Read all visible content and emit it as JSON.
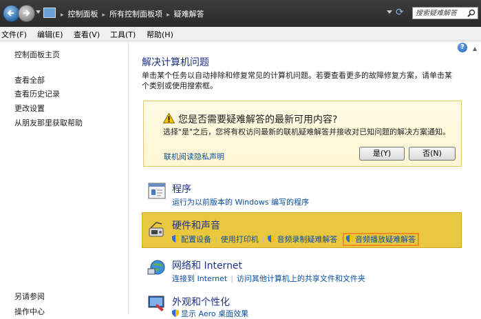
{
  "address_bar": {
    "breadcrumbs": [
      "控制面板",
      "所有控制面板项",
      "疑难解答"
    ],
    "search_placeholder": "搜索疑难解答"
  },
  "menu": [
    "文件(F)",
    "编辑(E)",
    "查看(V)",
    "工具(T)",
    "帮助(H)"
  ],
  "sidebar": {
    "links": [
      "控制面板主页",
      "查看全部",
      "查看历史记录",
      "更改设置",
      "从朋友那里获取帮助"
    ],
    "see_also_heading": "另请参阅",
    "see_also_links": [
      "操作中心"
    ]
  },
  "main": {
    "help_icon_label": "?",
    "title": "解决计算机问题",
    "description": "单击某个任务以自动排除和修复常见的计算机问题。若要查看更多的故障修复方案，请单击某个类别或使用搜索框。",
    "notice": {
      "question": "您是否需要疑难解答的最新可用内容?",
      "body": "选择\"是\"之后，您将有权访问最新的联机疑难解答并接收对已知问题的解决方案通知。",
      "privacy_link": "联机阅读隐私声明",
      "yes_button": "是(Y)",
      "no_button": "否(N)"
    },
    "categories": [
      {
        "title": "程序",
        "links": [
          "运行为以前版本的 Windows 编写的程序"
        ]
      },
      {
        "title": "硬件和声音",
        "links": [
          "配置设备",
          "使用打印机",
          "音频录制疑难解答",
          "音频播放疑难解答"
        ]
      },
      {
        "title": "网络和 Internet",
        "links": [
          "连接到 Internet",
          "访问其他计算机上的共享文件和文件夹"
        ]
      },
      {
        "title": "外观和个性化",
        "links": [
          "显示 Aero 桌面效果"
        ]
      }
    ]
  },
  "colors": {
    "highlight_row": "#e9c73f",
    "highlight_border": "#f08a22",
    "link": "#0b4ea0",
    "heading": "#1e3287"
  }
}
